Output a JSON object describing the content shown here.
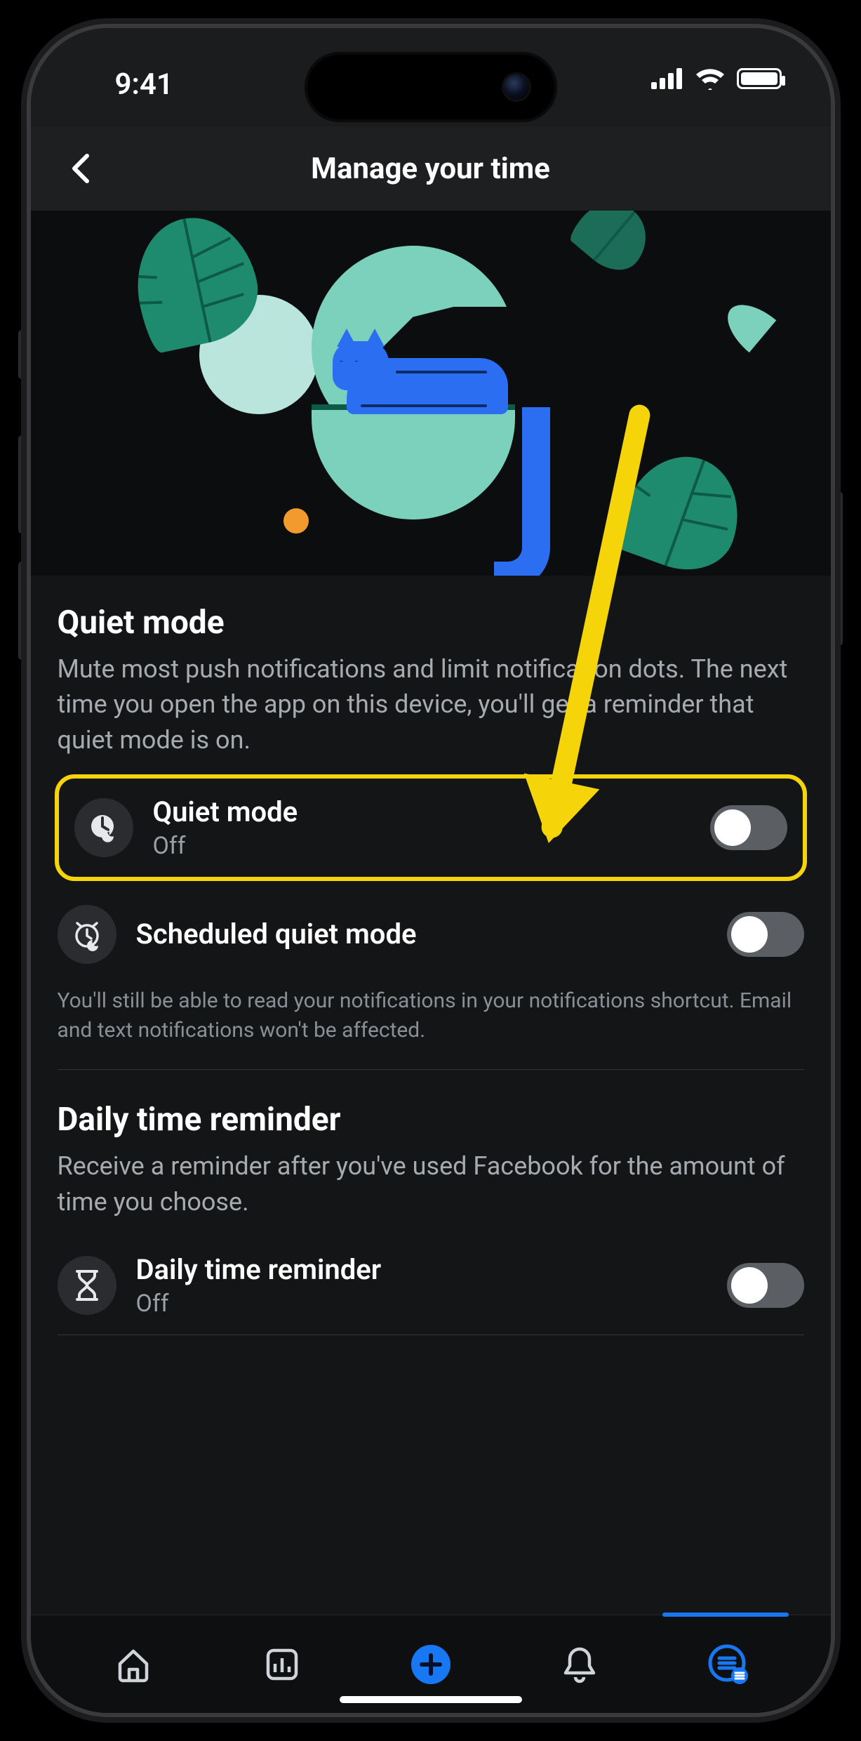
{
  "status": {
    "time": "9:41"
  },
  "header": {
    "title": "Manage your time"
  },
  "quiet_section": {
    "title": "Quiet mode",
    "desc": "Mute most push notifications and limit notification dots. The next time you open the app on this device, you'll get a reminder that quiet mode is on.",
    "quiet_row": {
      "label": "Quiet mode",
      "value": "Off"
    },
    "scheduled_row": {
      "label": "Scheduled quiet mode"
    },
    "note": "You'll still be able to read your notifications in your notifications shortcut. Email and text notifications won't be affected."
  },
  "daily_section": {
    "title": "Daily time reminder",
    "desc": "Receive a reminder after you've used Facebook for the amount of time you choose.",
    "row": {
      "label": "Daily time reminder",
      "value": "Off"
    }
  },
  "colors": {
    "accent": "#1877f2",
    "highlight": "#f5d50a"
  }
}
